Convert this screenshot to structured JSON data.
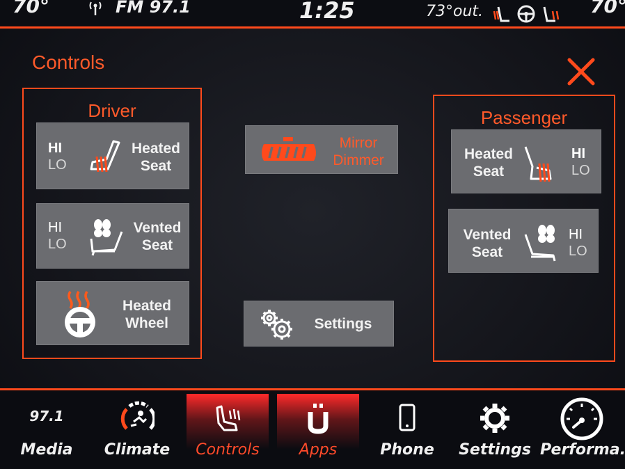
{
  "status_bar": {
    "temp_left": "70°",
    "radio": "FM 97.1",
    "time": "1:25",
    "outside_temp": "73°out.",
    "temp_right": "70°"
  },
  "header": {
    "title": "Controls"
  },
  "driver": {
    "title": "Driver",
    "heated_seat": {
      "hi": "HI",
      "lo": "LO",
      "label_1": "Heated",
      "label_2": "Seat"
    },
    "vented_seat": {
      "hi": "HI",
      "lo": "LO",
      "label_1": "Vented",
      "label_2": "Seat"
    },
    "heated_wheel": {
      "label_1": "Heated",
      "label_2": "Wheel"
    }
  },
  "center": {
    "mirror_dimmer": {
      "label_1": "Mirror",
      "label_2": "Dimmer"
    },
    "settings": {
      "label": "Settings"
    }
  },
  "passenger": {
    "title": "Passenger",
    "heated_seat": {
      "hi": "HI",
      "lo": "LO",
      "label_1": "Heated",
      "label_2": "Seat"
    },
    "vented_seat": {
      "hi": "HI",
      "lo": "LO",
      "label_1": "Vented",
      "label_2": "Seat"
    }
  },
  "nav": {
    "media_freq": "97.1",
    "items": [
      {
        "label": "Media",
        "icon": "radio-frequency-icon"
      },
      {
        "label": "Climate",
        "icon": "climate-icon"
      },
      {
        "label": "Controls",
        "icon": "seat-controls-icon",
        "active": true
      },
      {
        "label": "Apps",
        "icon": "apps-icon",
        "active": true
      },
      {
        "label": "Phone",
        "icon": "phone-icon"
      },
      {
        "label": "Settings",
        "icon": "gear-icon"
      },
      {
        "label": "Performa..",
        "icon": "gauge-icon"
      }
    ]
  },
  "colors": {
    "accent": "#ff4a1c",
    "button_bg": "#6b6c70",
    "background": "#15161c"
  }
}
